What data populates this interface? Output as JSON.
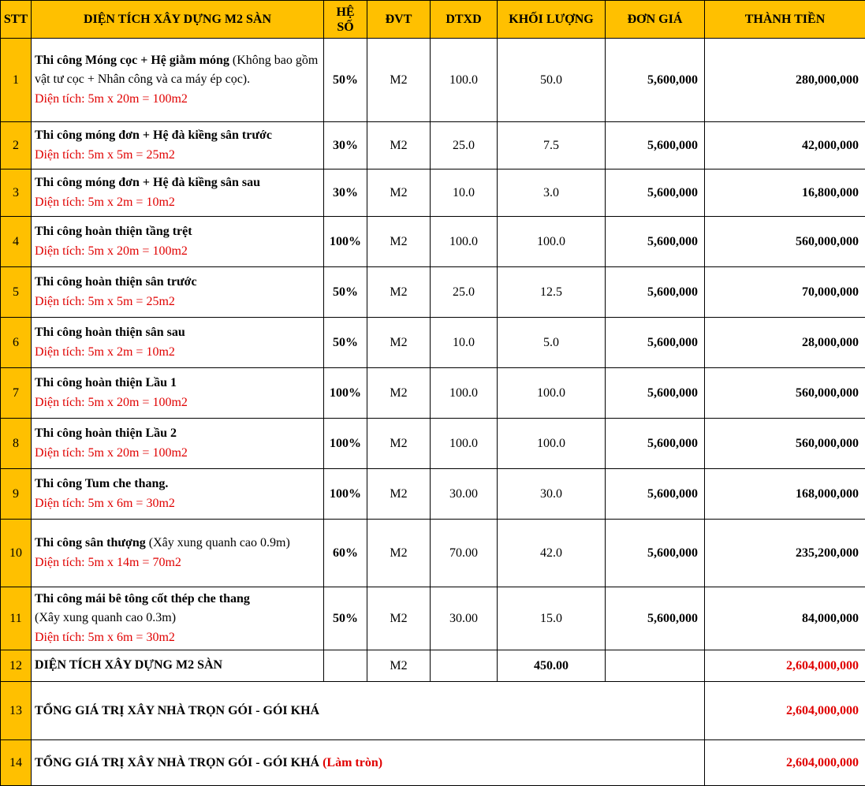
{
  "header": {
    "stt": "STT",
    "desc": "DIỆN TÍCH XÂY DỰNG M2 SÀN",
    "coef_line1": "HỆ",
    "coef_line2": "SỐ",
    "unit": "ĐVT",
    "area": "DTXD",
    "qty": "KHỐI LƯỢNG",
    "price": "ĐƠN GIÁ",
    "amount": "THÀNH TIỀN"
  },
  "rows": [
    {
      "stt": "1",
      "title": "Thi công Móng cọc + Hệ giằm móng",
      "note": " (Không bao gồm vật tư cọc + Nhân công và ca máy ép cọc).",
      "area_text": "Diện tích: 5m x 20m = 100m2",
      "coef": "50%",
      "unit": "M2",
      "dtxd": "100.0",
      "qty": "50.0",
      "price": "5,600,000",
      "amount": "280,000,000"
    },
    {
      "stt": "2",
      "title": "Thi công móng đơn + Hệ đà kiềng sân trước",
      "note": "",
      "area_text": "Diện tích: 5m x 5m = 25m2",
      "coef": "30%",
      "unit": "M2",
      "dtxd": "25.0",
      "qty": "7.5",
      "price": "5,600,000",
      "amount": "42,000,000"
    },
    {
      "stt": "3",
      "title": "Thi công móng đơn + Hệ đà kiềng sân sau",
      "note": "",
      "area_text": "Diện tích: 5m x 2m = 10m2",
      "coef": "30%",
      "unit": "M2",
      "dtxd": "10.0",
      "qty": "3.0",
      "price": "5,600,000",
      "amount": "16,800,000"
    },
    {
      "stt": "4",
      "title": "Thi công hoàn thiện tầng trệt",
      "note": "",
      "area_text": "Diện tích: 5m x 20m = 100m2",
      "coef": "100%",
      "unit": "M2",
      "dtxd": "100.0",
      "qty": "100.0",
      "price": "5,600,000",
      "amount": "560,000,000"
    },
    {
      "stt": "5",
      "title": "Thi công hoàn thiện sân trước",
      "note": "",
      "area_text": "Diện tích: 5m x 5m = 25m2",
      "coef": "50%",
      "unit": "M2",
      "dtxd": "25.0",
      "qty": "12.5",
      "price": "5,600,000",
      "amount": "70,000,000"
    },
    {
      "stt": "6",
      "title": "Thi công hoàn thiện sân sau",
      "note": "",
      "area_text": "Diện tích: 5m x 2m = 10m2",
      "coef": "50%",
      "unit": "M2",
      "dtxd": "10.0",
      "qty": "5.0",
      "price": "5,600,000",
      "amount": "28,000,000"
    },
    {
      "stt": "7",
      "title": "Thi công hoàn thiện Lầu 1",
      "note": "",
      "area_text": "Diện tích: 5m x 20m = 100m2",
      "coef": "100%",
      "unit": "M2",
      "dtxd": "100.0",
      "qty": "100.0",
      "price": "5,600,000",
      "amount": "560,000,000"
    },
    {
      "stt": "8",
      "title": "Thi công hoàn thiện Lầu 2",
      "note": "",
      "area_text": "Diện tích: 5m x 20m = 100m2",
      "coef": "100%",
      "unit": "M2",
      "dtxd": "100.0",
      "qty": "100.0",
      "price": "5,600,000",
      "amount": "560,000,000"
    },
    {
      "stt": "9",
      "title": "Thi công Tum che thang.",
      "note": "",
      "area_text": "Diện tích: 5m x 6m = 30m2",
      "coef": "100%",
      "unit": "M2",
      "dtxd": "30.00",
      "qty": "30.0",
      "price": "5,600,000",
      "amount": "168,000,000"
    },
    {
      "stt": "10",
      "title": "Thi công sân thượng",
      "note": " (Xây xung quanh cao 0.9m)",
      "area_text": " Diện tích: 5m x 14m = 70m2",
      "coef": "60%",
      "unit": "M2",
      "dtxd": "70.00",
      "qty": "42.0",
      "price": "5,600,000",
      "amount": "235,200,000"
    },
    {
      "stt": "11",
      "title": "Thi công mái bê tông cốt thép che thang",
      "note": " (Xây xung quanh cao 0.3m)",
      "area_text": "Diện tích: 5m x 6m = 30m2",
      "coef": "50%",
      "unit": "M2",
      "dtxd": "30.00",
      "qty": "15.0",
      "price": "5,600,000",
      "amount": "84,000,000"
    }
  ],
  "summary": {
    "row12": {
      "stt": "12",
      "label": "DIỆN TÍCH XÂY DỰNG M2 SÀN",
      "unit": "M2",
      "qty": "450.00",
      "amount": "2,604,000,000"
    },
    "row13": {
      "stt": "13",
      "label": "TỔNG GIÁ TRỊ  XÂY NHÀ TRỌN GÓI - GÓI KHÁ",
      "amount": "2,604,000,000"
    },
    "row14": {
      "stt": "14",
      "label": "TỔNG GIÁ TRỊ  XÂY NHÀ TRỌN GÓI - GÓI KHÁ",
      "label_suffix": " (Làm tròn)",
      "amount": "2,604,000,000"
    }
  },
  "colors": {
    "header_bg": "#ffc000",
    "accent_red": "#e00000"
  }
}
